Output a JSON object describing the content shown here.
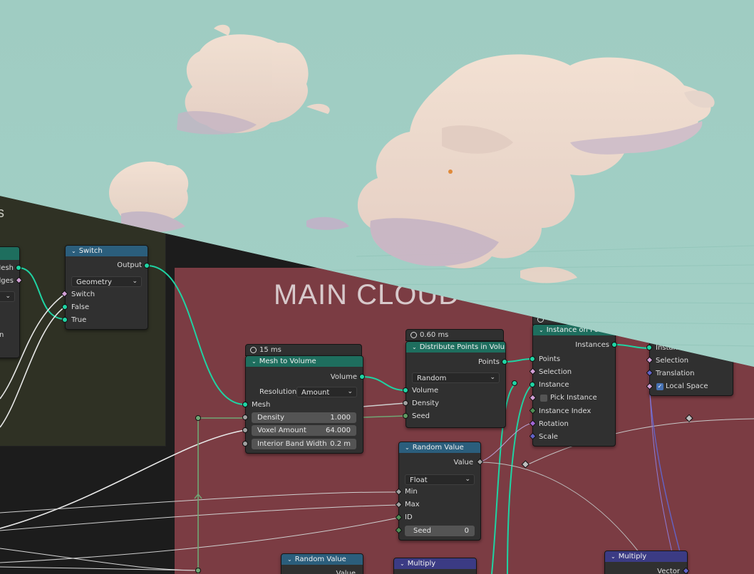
{
  "frames": {
    "left_label": "s",
    "main_label": "MAIN CLOUD"
  },
  "nodes": {
    "edge_left": {
      "mesh_label": "Mesh",
      "edges_label": "dges",
      "dd_arrow": "⌄",
      "n_label": "n"
    },
    "switch": {
      "title": "Switch",
      "output": "Output",
      "type_value": "Geometry",
      "switch_label": "Switch",
      "false_label": "False",
      "true_label": "True"
    },
    "mesh_to_volume": {
      "timer": "15 ms",
      "title": "Mesh to Volume",
      "volume_out": "Volume",
      "resolution_label": "Resolution",
      "resolution_value": "Amount",
      "mesh_label": "Mesh",
      "density_label": "Density",
      "density_value": "1.000",
      "voxel_label": "Voxel Amount",
      "voxel_value": "64.000",
      "band_label": "Interior Band Width",
      "band_value": "0.2 m"
    },
    "distribute": {
      "timer": "0.60 ms",
      "title": "Distribute Points in Volume",
      "points_out": "Points",
      "mode_value": "Random",
      "volume_label": "Volume",
      "density_label": "Density",
      "seed_label": "Seed"
    },
    "instance_on_points": {
      "title": "Instance on Points",
      "instances_out": "Instances",
      "points_label": "Points",
      "selection_label": "Selection",
      "instance_label": "Instance",
      "pick_label": "Pick Instance",
      "index_label": "Instance Index",
      "rotation_label": "Rotation",
      "scale_label": "Scale"
    },
    "translate": {
      "instance_label": "Instance",
      "selection_label": "Selection",
      "translation_label": "Translation",
      "local_label": "Local Space"
    },
    "random_value": {
      "title": "Random Value",
      "value_out": "Value",
      "type_value": "Float",
      "min_label": "Min",
      "max_label": "Max",
      "id_label": "ID",
      "seed_label": "Seed",
      "seed_value": "0"
    },
    "random_value_2": {
      "title": "Random Value",
      "value_out": "Value"
    },
    "multiply_1": {
      "title": "Multiply"
    },
    "multiply_2": {
      "title": "Multiply",
      "vector_out": "Vector"
    }
  },
  "colors": {
    "sky": "#9ccbc0",
    "main_frame": "#7b3c43",
    "left_frame": "#2f3124",
    "geometry_header": "#1e6e5e",
    "utility_header": "#2b5e7c",
    "math_header": "#3b3b84",
    "geometry_socket": "#20d5a4"
  }
}
